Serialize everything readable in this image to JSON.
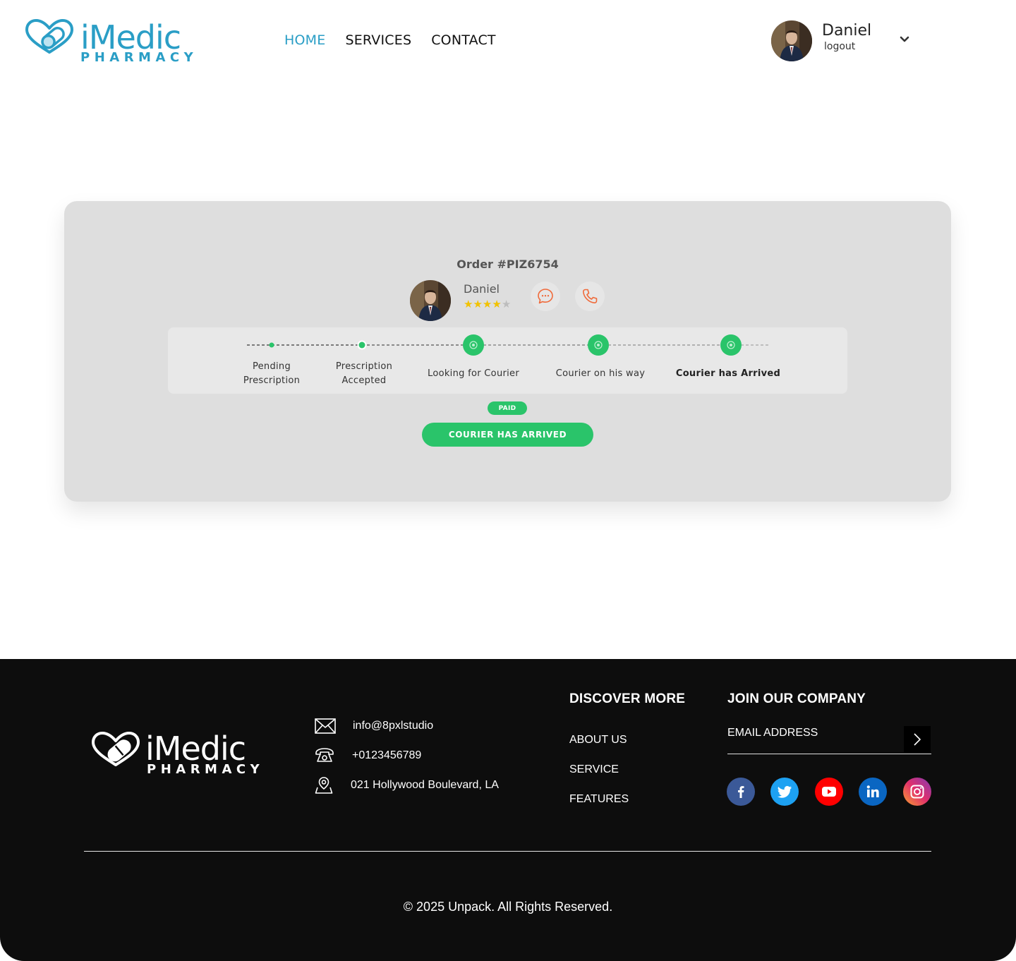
{
  "brand": {
    "name": "iMedic",
    "tagline": "PHARMACY",
    "color": "#2a9ec6"
  },
  "nav": {
    "items": [
      {
        "label": "HOME",
        "active": true
      },
      {
        "label": "SERVICES",
        "active": false
      },
      {
        "label": "CONTACT",
        "active": false
      }
    ]
  },
  "user": {
    "name": "Daniel",
    "logout_label": "logout",
    "menu_icon": "chevron-down-icon"
  },
  "order": {
    "title": "Order #PIZ6754",
    "courier_name": "Daniel",
    "rating": 4,
    "rating_max": 5,
    "message_icon": "chat-icon",
    "call_icon": "phone-icon",
    "steps": [
      {
        "label_line1": "Pending",
        "label_line2": "Prescription"
      },
      {
        "label_line1": "Prescription",
        "label_line2": "Accepted"
      },
      {
        "label_line1": "Looking for Courier",
        "label_line2": ""
      },
      {
        "label_line1": "Courier on his way",
        "label_line2": ""
      },
      {
        "label_line1": "Courier has Arrived",
        "label_line2": ""
      }
    ],
    "payment_badge": "PAID",
    "status_button": "COURIER HAS ARRIVED",
    "accent": "#2ac46a"
  },
  "footer": {
    "email": "info@8pxlstudio",
    "phone": "+0123456789",
    "address": "021 Hollywood Boulevard, LA",
    "discover_heading": "DISCOVER MORE",
    "links": [
      "ABOUT US",
      "SERVICE",
      "FEATURES"
    ],
    "join_heading": "JOIN OUR COMPANY",
    "email_placeholder": "EMAIL ADDRESS",
    "social": [
      {
        "name": "facebook-icon",
        "color": "#3b5998"
      },
      {
        "name": "twitter-icon",
        "color": "#1da1f2"
      },
      {
        "name": "youtube-icon",
        "color": "#ff0000"
      },
      {
        "name": "linkedin-icon",
        "color": "#0a66c2"
      },
      {
        "name": "instagram-icon",
        "color": "#c13584"
      }
    ],
    "copyright": "© 2025 Unpack. All Rights Reserved."
  }
}
